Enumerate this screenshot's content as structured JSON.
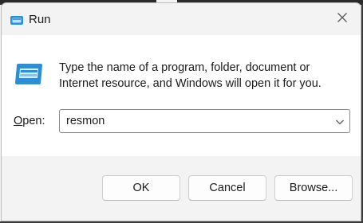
{
  "window": {
    "title": "Run",
    "title_icon": "run-icon",
    "close_icon": "close-icon"
  },
  "content": {
    "app_icon": "run-dialog-icon",
    "description": "Type the name of a program, folder, document or Internet resource, and Windows will open it for you.",
    "open_label_prefix": "O",
    "open_label_rest": "pen:",
    "open_value": "resmon",
    "dropdown_icon": "chevron-down-icon"
  },
  "buttons": {
    "ok": "OK",
    "cancel": "Cancel",
    "browse": "Browse..."
  },
  "colors": {
    "accent_blue": "#2b8fd6",
    "window_bg": "#f3f3f3",
    "content_bg": "#ffffff"
  }
}
